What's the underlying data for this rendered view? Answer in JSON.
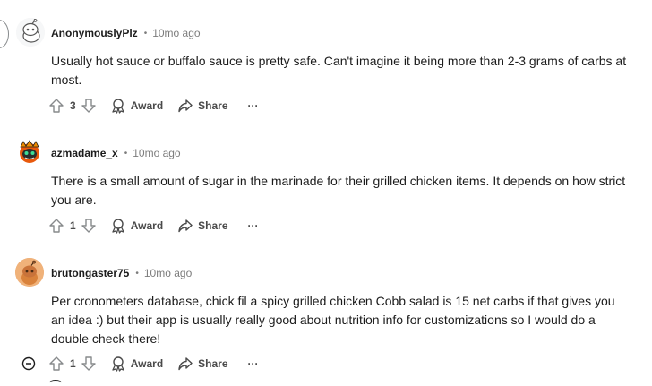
{
  "comments": [
    {
      "username": "AnonymouslyPlz",
      "separator": "•",
      "timestamp": "10mo ago",
      "body": "Usually hot sauce or buffalo sauce is pretty safe. Can't imagine it being more than 2-3 grams of carbs at most.",
      "votes": "3",
      "award_label": "Award",
      "share_label": "Share",
      "more_label": "···",
      "avatar_icon": "snoo-avatar-icon"
    },
    {
      "username": "azmadame_x",
      "separator": "•",
      "timestamp": "10mo ago",
      "body": "There is a small amount of sugar in the marinade for their grilled chicken items. It depends on how strict you are.",
      "votes": "1",
      "award_label": "Award",
      "share_label": "Share",
      "more_label": "···",
      "avatar_icon": "snoo-avatar-icon"
    },
    {
      "username": "brutongaster75",
      "separator": "•",
      "timestamp": "10mo ago",
      "body": "Per cronometers database, chick fil a spicy grilled chicken Cobb salad is 15 net carbs if that gives you an idea :) but their app is usually really good about nutrition info for customizations so I would do a double check there!",
      "votes": "1",
      "award_label": "Award",
      "share_label": "Share",
      "more_label": "···",
      "avatar_icon": "snoo-avatar-icon"
    }
  ],
  "colors": {
    "text": "#1c1c1c",
    "muted": "#7c7c7c",
    "action": "#4a4a4a",
    "thread": "#edeff1",
    "avatar_orange": "#e8a46b"
  }
}
